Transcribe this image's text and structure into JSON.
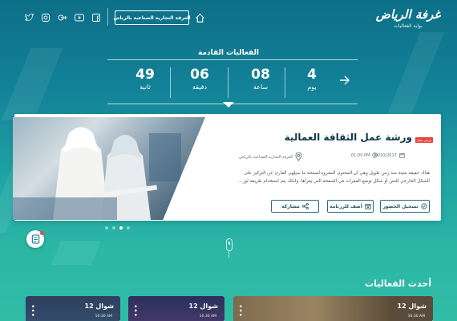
{
  "header": {
    "logo_text": "غرفة الرياض",
    "logo_subtitle": "بوابة الفعاليات",
    "chamber_button": "الغرفة التجارية الصناعية بالرياض",
    "social_icons": [
      "twitter-icon",
      "instagram-icon",
      "google-plus-icon",
      "youtube-icon",
      "facebook-icon"
    ]
  },
  "countdown": {
    "title": "الفعاليات القادمة",
    "units": [
      {
        "value": "4",
        "label": "يوم"
      },
      {
        "value": "08",
        "label": "ساعة"
      },
      {
        "value": "06",
        "label": "دقيقة"
      },
      {
        "value": "49",
        "label": "ثانية"
      }
    ]
  },
  "featured": {
    "badge": "ورش عمل",
    "title": "ورشة عمل الثقافة العمالية",
    "date": "24/10/2017",
    "time": "01:00 PM",
    "location": "الغرفة التجارية الصناعية بالرياض",
    "description": "هناك حقيقة مثبتة منذ زمن طويل وهي أن المحتوى المقروء لصفحة ما سيلهي القارئ عن التركيز على الشكل الخارجي للنص أو شكل توضع الفقرات في الصفحة التي يقرأها. ولذلك يتم استخدام طريقة لوريم إيبسوم لأنها تعطي توزيعاَ طبيعياَ -إلى حد ما- للأحرف عوضاً عن استخدام \"هنا يوجد محتوى نصي، هنا يوجد محتوى نصي\" فتجعلها تبدو (أي الأحرف) وكأنها نص مقروء. العديد من برامح النشر المكتبي وبرامح تحرير صفحات الويب...",
    "buttons": {
      "register": "تسجيل الحضور",
      "add_schedule": "أضف للرزنامة",
      "share": "مشاركة"
    },
    "slides_count": 4,
    "active_slide": 3
  },
  "latest": {
    "title": "أحدث الفعاليات",
    "cards": [
      {
        "date": "12 شوال",
        "time": "10:30 AM"
      },
      {
        "date": "12 شوال",
        "time": "10:30 AM"
      },
      {
        "date": "12 شوال",
        "time": "10:30 AM"
      }
    ]
  },
  "colors": {
    "accent_red": "#e6473f",
    "title_dark": "#0d3848",
    "button_border": "#2a6a80"
  }
}
